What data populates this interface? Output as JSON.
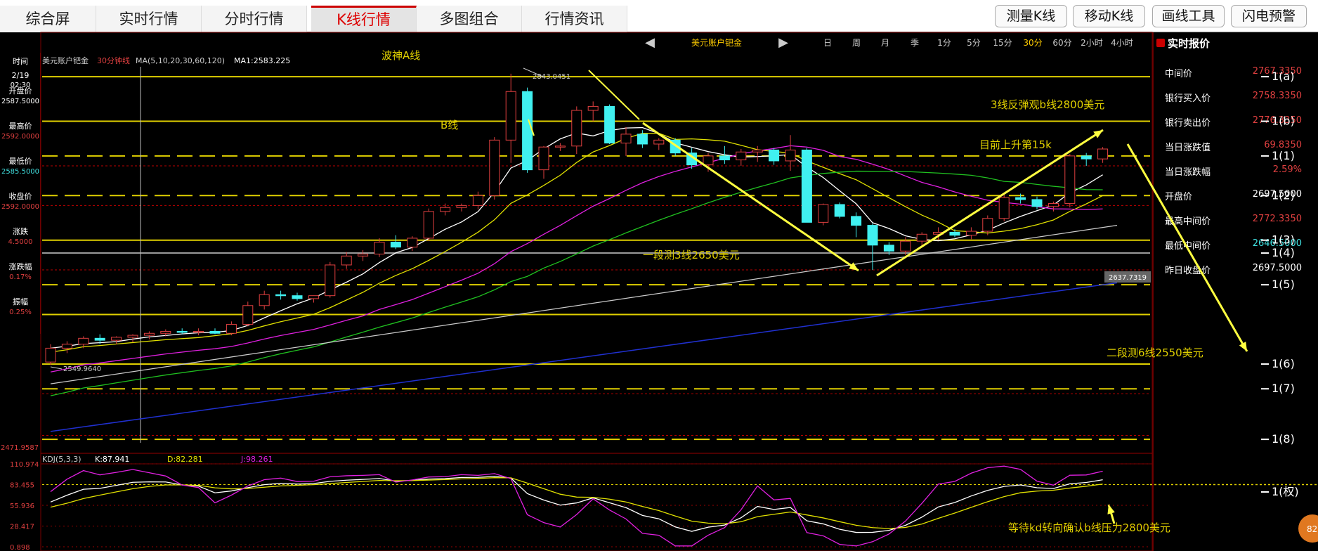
{
  "tabs": [
    {
      "label": "综合屏",
      "active": false
    },
    {
      "label": "实时行情",
      "active": false
    },
    {
      "label": "分时行情",
      "active": false
    },
    {
      "label": "K线行情",
      "active": true
    },
    {
      "label": "多图组合",
      "active": false
    },
    {
      "label": "行情资讯",
      "active": false
    }
  ],
  "toolbar_buttons": [
    "测量K线",
    "移动K线",
    "画线工具",
    "闪电预警"
  ],
  "nav": {
    "prev": "◀",
    "symbol": "美元账户钯金",
    "next": "▶"
  },
  "periods": [
    {
      "label": "日",
      "active": false
    },
    {
      "label": "周",
      "active": false
    },
    {
      "label": "月",
      "active": false
    },
    {
      "label": "季",
      "active": false
    },
    {
      "label": "1分",
      "active": false
    },
    {
      "label": "5分",
      "active": false
    },
    {
      "label": "15分",
      "active": false
    },
    {
      "label": "30分",
      "active": true
    },
    {
      "label": "60分",
      "active": false
    },
    {
      "label": "2小时",
      "active": false
    },
    {
      "label": "4小时",
      "active": false
    }
  ],
  "header": {
    "symbol": "美元账户钯金",
    "period": "30分钟线",
    "ma_params": "MA(5,10,20,30,60,120)",
    "ma1": "MA1:2583.225"
  },
  "left_panel": [
    {
      "label": "时间",
      "value": ""
    },
    {
      "label": "2/19",
      "value": "02:30"
    },
    {
      "label": "开盘价",
      "value": "2587.5000"
    },
    {
      "label": "最高价",
      "value": "2592.0000"
    },
    {
      "label": "最低价",
      "value": "2585.5000"
    },
    {
      "label": "收盘价",
      "value": "2592.0000"
    },
    {
      "label": "涨跌",
      "value": "4.5000"
    },
    {
      "label": "涨跌幅",
      "value": "0.17%"
    },
    {
      "label": "振幅",
      "value": "0.25%"
    }
  ],
  "quote": {
    "title": "实时报价",
    "rows": [
      {
        "label": "中间价",
        "value": "2767.3350",
        "color": "#e04040"
      },
      {
        "label": "银行买入价",
        "value": "2758.3350",
        "color": "#e04040"
      },
      {
        "label": "银行卖出价",
        "value": "2776.3350",
        "color": "#e04040"
      },
      {
        "label": "当日涨跌值",
        "value": "69.8350",
        "color": "#e04040"
      },
      {
        "label": "当日涨跌幅",
        "value": "2.59%",
        "color": "#e04040"
      },
      {
        "label": "开盘价",
        "value": "2697.5000",
        "color": "#ffffff"
      },
      {
        "label": "最高中间价",
        "value": "2772.3350",
        "color": "#e04040"
      },
      {
        "label": "最低中间价",
        "value": "2646.5000",
        "color": "#40e0e0"
      },
      {
        "label": "昨日收盘价",
        "value": "2697.5000",
        "color": "#ffffff"
      }
    ]
  },
  "chart_data": {
    "type": "candlestick",
    "ylim": [
      2471.9587,
      2850
    ],
    "price_labels": {
      "high_mark": "2843.0451",
      "low_mark": "2549.9640",
      "axis_bottom": "2471.9587",
      "current": "2637.7319"
    },
    "candles": [
      [
        2552,
        2570,
        2549,
        2566
      ],
      [
        2566,
        2573,
        2561,
        2570
      ],
      [
        2570,
        2578,
        2566,
        2576
      ],
      [
        2576,
        2580,
        2570,
        2574
      ],
      [
        2574,
        2578,
        2570,
        2577
      ],
      [
        2577,
        2580,
        2572,
        2579
      ],
      [
        2579,
        2583,
        2575,
        2581
      ],
      [
        2581,
        2585,
        2578,
        2583
      ],
      [
        2583,
        2586,
        2580,
        2582
      ],
      [
        2582,
        2586,
        2579,
        2583
      ],
      [
        2583,
        2586,
        2580,
        2581
      ],
      [
        2581,
        2593,
        2579,
        2590
      ],
      [
        2590,
        2613,
        2588,
        2609
      ],
      [
        2609,
        2624,
        2605,
        2620
      ],
      [
        2620,
        2624,
        2615,
        2619
      ],
      [
        2619,
        2622,
        2614,
        2616
      ],
      [
        2616,
        2619,
        2612,
        2619
      ],
      [
        2619,
        2653,
        2617,
        2650
      ],
      [
        2650,
        2663,
        2646,
        2659
      ],
      [
        2659,
        2665,
        2654,
        2661
      ],
      [
        2661,
        2677,
        2658,
        2673
      ],
      [
        2673,
        2680,
        2666,
        2668
      ],
      [
        2668,
        2679,
        2664,
        2677
      ],
      [
        2677,
        2707,
        2674,
        2704
      ],
      [
        2704,
        2712,
        2700,
        2708
      ],
      [
        2708,
        2712,
        2704,
        2710
      ],
      [
        2710,
        2724,
        2706,
        2720
      ],
      [
        2720,
        2779,
        2716,
        2776
      ],
      [
        2776,
        2843,
        2753,
        2825
      ],
      [
        2825,
        2829,
        2743,
        2746
      ],
      [
        2746,
        2770,
        2737,
        2769
      ],
      [
        2769,
        2773,
        2765,
        2770
      ],
      [
        2770,
        2810,
        2762,
        2806
      ],
      [
        2806,
        2815,
        2795,
        2810
      ],
      [
        2810,
        2812,
        2772,
        2773
      ],
      [
        2773,
        2789,
        2760,
        2782
      ],
      [
        2782,
        2786,
        2768,
        2772
      ],
      [
        2772,
        2778,
        2766,
        2776
      ],
      [
        2776,
        2778,
        2760,
        2763
      ],
      [
        2763,
        2768,
        2747,
        2751
      ],
      [
        2751,
        2763,
        2744,
        2760
      ],
      [
        2760,
        2770,
        2752,
        2756
      ],
      [
        2756,
        2767,
        2750,
        2764
      ],
      [
        2764,
        2770,
        2754,
        2766
      ],
      [
        2766,
        2768,
        2751,
        2755
      ],
      [
        2755,
        2781,
        2745,
        2766
      ],
      [
        2766,
        2768,
        2693,
        2693
      ],
      [
        2693,
        2712,
        2690,
        2711
      ],
      [
        2711,
        2713,
        2697,
        2699
      ],
      [
        2699,
        2703,
        2678,
        2690
      ],
      [
        2690,
        2692,
        2645,
        2670
      ],
      [
        2670,
        2673,
        2660,
        2664
      ],
      [
        2664,
        2678,
        2660,
        2674
      ],
      [
        2674,
        2683,
        2668,
        2681
      ],
      [
        2681,
        2688,
        2675,
        2683
      ],
      [
        2683,
        2686,
        2678,
        2680
      ],
      [
        2680,
        2688,
        2676,
        2684
      ],
      [
        2684,
        2700,
        2680,
        2697
      ],
      [
        2697,
        2722,
        2694,
        2718
      ],
      [
        2718,
        2722,
        2712,
        2716
      ],
      [
        2716,
        2719,
        2706,
        2709
      ],
      [
        2709,
        2714,
        2704,
        2712
      ],
      [
        2712,
        2762,
        2708,
        2760
      ],
      [
        2760,
        2763,
        2750,
        2757
      ],
      [
        2757,
        2769,
        2753,
        2767
      ]
    ],
    "hlines": [
      {
        "price": 2840,
        "style": "solid",
        "color": "#e0d000",
        "label": "波神A线"
      },
      {
        "price": 2795,
        "style": "solid",
        "color": "#e0d000",
        "label": "B线"
      },
      {
        "price": 2760,
        "style": "dashed",
        "color": "#e0d000"
      },
      {
        "price": 2720,
        "style": "dashed",
        "color": "#e0d000"
      },
      {
        "price": 2675,
        "style": "solid",
        "color": "#e0d000"
      },
      {
        "price": 2662,
        "style": "solid",
        "color": "#999999"
      },
      {
        "price": 2630,
        "style": "dashed",
        "color": "#e0d000"
      },
      {
        "price": 2600,
        "style": "solid",
        "color": "#e0d000"
      },
      {
        "price": 2550,
        "style": "solid",
        "color": "#e0d000"
      },
      {
        "price": 2525,
        "style": "dashed",
        "color": "#e0d000"
      },
      {
        "price": 2474,
        "style": "dashed",
        "color": "#e0d000"
      }
    ],
    "level_labels": [
      "1(a)",
      "1(b)",
      "1(1)",
      "1(2)",
      "1(3)",
      "1(4)",
      "1(5)",
      "1(6)",
      "1(7)",
      "1(8)",
      "1(权)"
    ],
    "annotations": [
      "一段测3线2650美元",
      "3线反弹观b线2800美元",
      "目前上升第15k",
      "二段测6线2550美元",
      "等待kd转向确认b线压力2800美元"
    ],
    "kdj": {
      "params": "KDJ(5,3,3)",
      "K": "K:87.941",
      "D": "D:82.281",
      "J": "J:98.261",
      "axis": [
        "110.974",
        "83.455",
        "55.936",
        "28.417",
        "0.898"
      ],
      "ylim": [
        0.898,
        110.974
      ]
    }
  },
  "badge": "82"
}
